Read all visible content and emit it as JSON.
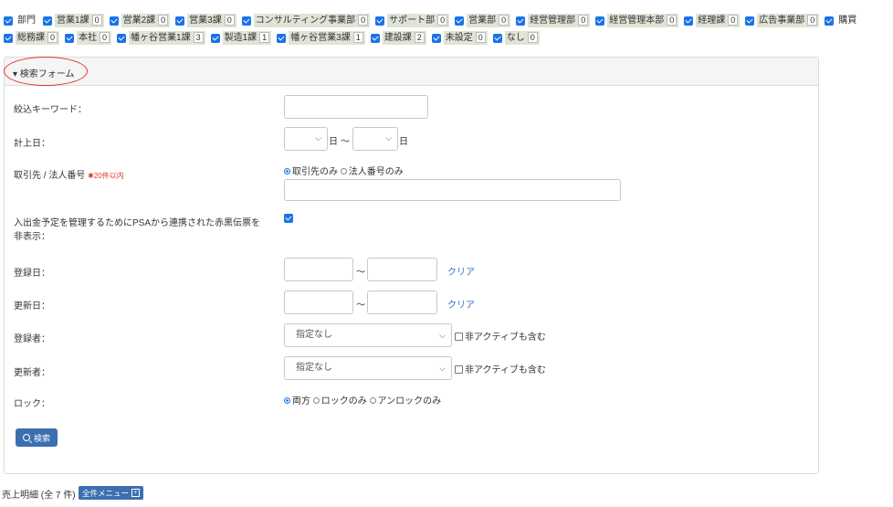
{
  "filters": {
    "row1": [
      {
        "label": "部門",
        "count": ""
      },
      {
        "label": "営業1課",
        "count": "0"
      },
      {
        "label": "営業2課",
        "count": "0"
      },
      {
        "label": "営業3課",
        "count": "0"
      },
      {
        "label": "コンサルティング事業部",
        "count": "0"
      },
      {
        "label": "サポート部",
        "count": "0"
      },
      {
        "label": "営業部",
        "count": "0"
      },
      {
        "label": "経営管理部",
        "count": "0"
      },
      {
        "label": "経営管理本部",
        "count": "0"
      },
      {
        "label": "経理課",
        "count": "0"
      },
      {
        "label": "広告事業部",
        "count": "0"
      },
      {
        "label": "購買",
        "count": ""
      }
    ],
    "row2": [
      {
        "label": "総務課",
        "count": "0"
      },
      {
        "label": "本社",
        "count": "0"
      },
      {
        "label": "幡ヶ谷営業1課",
        "count": "3"
      },
      {
        "label": "製造1課",
        "count": "1"
      },
      {
        "label": "幡ヶ谷営業3課",
        "count": "1"
      },
      {
        "label": "建設課",
        "count": "2"
      },
      {
        "label": "未設定",
        "count": "0"
      },
      {
        "label": "なし",
        "count": "0"
      }
    ]
  },
  "search_form": {
    "title": "▾ 検索フォーム",
    "keyword_label": "絞込キーワード：",
    "date_label": "計上日：",
    "day_unit": "日",
    "tilde": "〜",
    "partner_label": "取引先 / 法人番号",
    "partner_note": "✱20件以内",
    "radio_partner_only": "取引先のみ",
    "radio_corp_only": "法人番号のみ",
    "psa_label": "入出金予定を管理するためにPSAから連携された赤黒伝票を非表示：",
    "reg_date_label": "登録日：",
    "upd_date_label": "更新日：",
    "clear": "クリア",
    "registrant_label": "登録者：",
    "updater_label": "更新者：",
    "select_none": "指定なし",
    "include_inactive": "非アクティブも含む",
    "lock_label": "ロック：",
    "lock_both": "両方",
    "lock_locked": "ロックのみ",
    "lock_unlocked": "アンロックのみ",
    "search_button": "検索"
  },
  "footer": {
    "summary": "売上明細 (全 7 件)",
    "menu_button": "全件メニュー"
  }
}
